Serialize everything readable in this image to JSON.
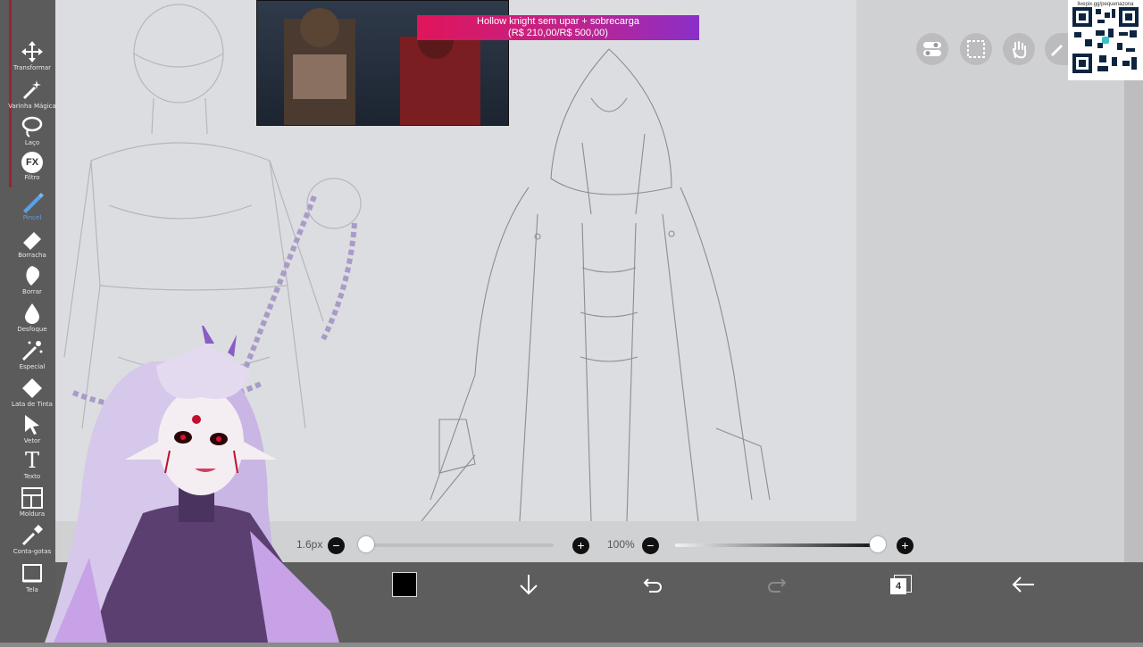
{
  "toolbar": {
    "tools": [
      {
        "label": "Transformar",
        "icon": "move-icon"
      },
      {
        "label": "Varinha Mágica",
        "icon": "magic-wand-icon"
      },
      {
        "label": "Laço",
        "icon": "lasso-icon"
      },
      {
        "label": "Filtro",
        "icon": "fx-icon",
        "glyph": "FX"
      },
      {
        "label": "Pincel",
        "icon": "brush-icon"
      },
      {
        "label": "Borracha",
        "icon": "eraser-icon"
      },
      {
        "label": "Borrar",
        "icon": "smudge-icon"
      },
      {
        "label": "Desfoque",
        "icon": "blur-drop-icon"
      },
      {
        "label": "Especial",
        "icon": "special-wand-icon"
      },
      {
        "label": "Lata de Tinta",
        "icon": "paint-bucket-icon"
      },
      {
        "label": "Vetor",
        "icon": "vector-cursor-icon"
      },
      {
        "label": "Texto",
        "icon": "text-tool-icon",
        "glyph": "T"
      },
      {
        "label": "Moldura",
        "icon": "frame-divider-icon"
      },
      {
        "label": "Conta-gotas",
        "icon": "eyedropper-icon"
      },
      {
        "label": "Tela",
        "icon": "canvas-icon"
      }
    ],
    "active_index": 4
  },
  "banner": {
    "line1": "Hollow knight sem upar + sobrecarga",
    "line2": "(R$ 210,00/R$ 500,00)"
  },
  "qr": {
    "caption": "livepix.gg/pequenazona"
  },
  "sliders": {
    "size_label": "1.6px",
    "size_value_fraction": 0.0,
    "opacity_label": "100%",
    "opacity_value_fraction": 1.0,
    "minus_glyph": "−",
    "plus_glyph": "+"
  },
  "bottom_bar": {
    "layers_count": "4",
    "icons": [
      "color-swatch-icon",
      "download-arrow-icon",
      "undo-icon",
      "redo-icon",
      "layers-icon",
      "back-arrow-icon"
    ],
    "swatch_color": "#000000"
  },
  "top_right": {
    "icons": [
      "toggle-panel-icon",
      "selection-rect-icon",
      "hand-tool-icon",
      "pen-icon"
    ]
  },
  "colors": {
    "toolbar_bg": "#5b5b5b",
    "canvas_bg": "#dcdde0",
    "active_tool": "#5aa0e8",
    "banner_start": "#e0155a",
    "banner_end": "#8a2fc8"
  }
}
